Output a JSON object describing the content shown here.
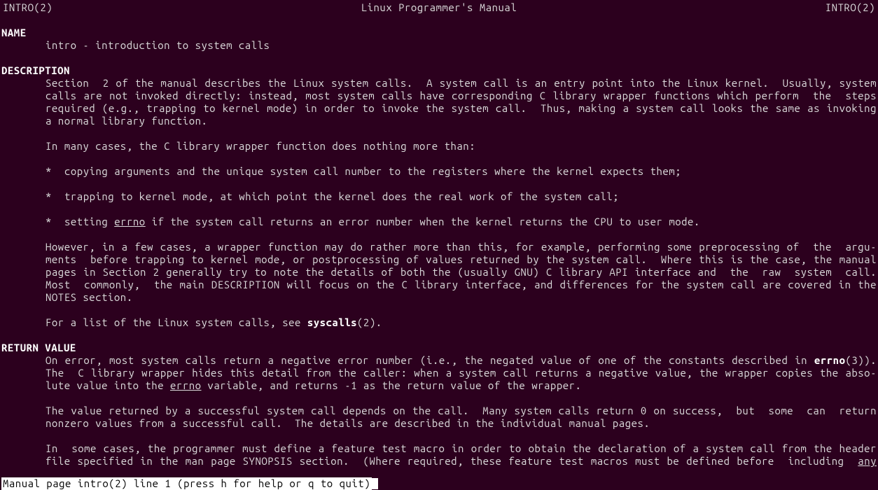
{
  "header": {
    "left": "INTRO(2)",
    "center": "Linux Programmer's Manual",
    "right": "INTRO(2)"
  },
  "sections": {
    "name": {
      "heading": "NAME",
      "content": "intro - introduction to system calls"
    },
    "description": {
      "heading": "DESCRIPTION",
      "para1_l1": "Section  2 of the manual describes the Linux system calls.  A system call is an entry point into the Linux kernel.  Usually, system",
      "para1_l2": "calls are not invoked directly: instead, most system calls have corresponding C library wrapper functions which perform  the  steps",
      "para1_l3": "required (e.g., trapping to kernel mode) in order to invoke the system call.  Thus, making a system call looks the same as invoking",
      "para1_l4": "a normal library function.",
      "para2": "In many cases, the C library wrapper function does nothing more than:",
      "bullet1": "copying arguments and the unique system call number to the registers where the kernel expects them;",
      "bullet2": "trapping to kernel mode, at which point the kernel does the real work of the system call;",
      "bullet3_pre": "setting ",
      "bullet3_errno": "errno",
      "bullet3_post": " if the system call returns an error number when the kernel returns the CPU to user mode.",
      "para3_l1": "However, in a few cases, a wrapper function may do rather more than this, for example, performing some preprocessing of  the  argu-",
      "para3_l2": "ments  before trapping to kernel mode, or postprocessing of values returned by the system call.  Where this is the case, the manual",
      "para3_l3": "pages in Section 2 generally try to note the details of both the (usually GNU) C library API interface and  the  raw  system  call.",
      "para3_l4": "Most  commonly,  the main DESCRIPTION will focus on the C library interface, and differences for the system call are covered in the",
      "para3_l5": "NOTES section.",
      "para4_pre": "For a list of the Linux system calls, see ",
      "para4_bold": "syscalls",
      "para4_post": "(2)."
    },
    "return_value": {
      "heading": "RETURN VALUE",
      "para1_l1_pre": "On error, most system calls return a negative error number (i.e., the negated value of one of the constants described in ",
      "para1_l1_bold": "errno",
      "para1_l1_post": "(3)).",
      "para1_l2": "The  C library wrapper hides this detail from the caller: when a system call returns a negative value, the wrapper copies the abso-",
      "para1_l3_pre": "lute value into the ",
      "para1_l3_errno": "errno",
      "para1_l3_post": " variable, and returns -1 as the return value of the wrapper.",
      "para2_l1": "The value returned by a successful system call depends on the call.  Many system calls return 0 on success,  but  some  can  return",
      "para2_l2": "nonzero values from a successful call.  The details are described in the individual manual pages.",
      "para3_l1": "In  some cases, the programmer must define a feature test macro in order to obtain the declaration of a system call from the header",
      "para3_l2_pre": "file specified in the man page SYNOPSIS section.  (Where required, these feature test macros must be defined before  including  ",
      "para3_l2_any": "any"
    }
  },
  "status": " Manual page intro(2) line 1 (press h for help or q to quit)"
}
